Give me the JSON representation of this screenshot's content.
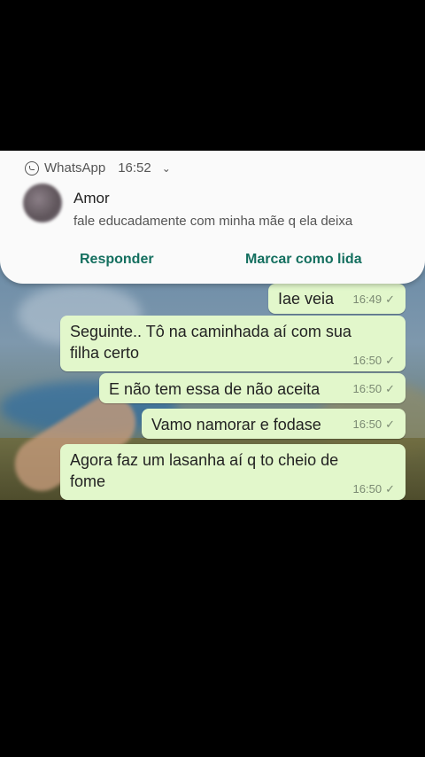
{
  "notification": {
    "app_name": "WhatsApp",
    "time": "16:52",
    "sender": "Amor",
    "preview": "fale educadamente com minha mãe q ela deixa",
    "actions": [
      "Responder",
      "Marcar como lida"
    ]
  },
  "messages": [
    {
      "text": "Iae veia",
      "time": "16:49",
      "status": "✓"
    },
    {
      "text": "Seguinte.. Tô na caminhada aí com sua filha certo",
      "time": "16:50",
      "status": "✓"
    },
    {
      "text": "E não tem essa de não aceita",
      "time": "16:50",
      "status": "✓"
    },
    {
      "text": "Vamo namorar e fodase",
      "time": "16:50",
      "status": "✓"
    },
    {
      "text": "Agora faz um lasanha aí q to cheio de fome",
      "time": "16:50",
      "status": "✓"
    }
  ],
  "colors": {
    "bubble": "#e2f7cb",
    "accent": "#146f5f",
    "background": "#000000"
  }
}
